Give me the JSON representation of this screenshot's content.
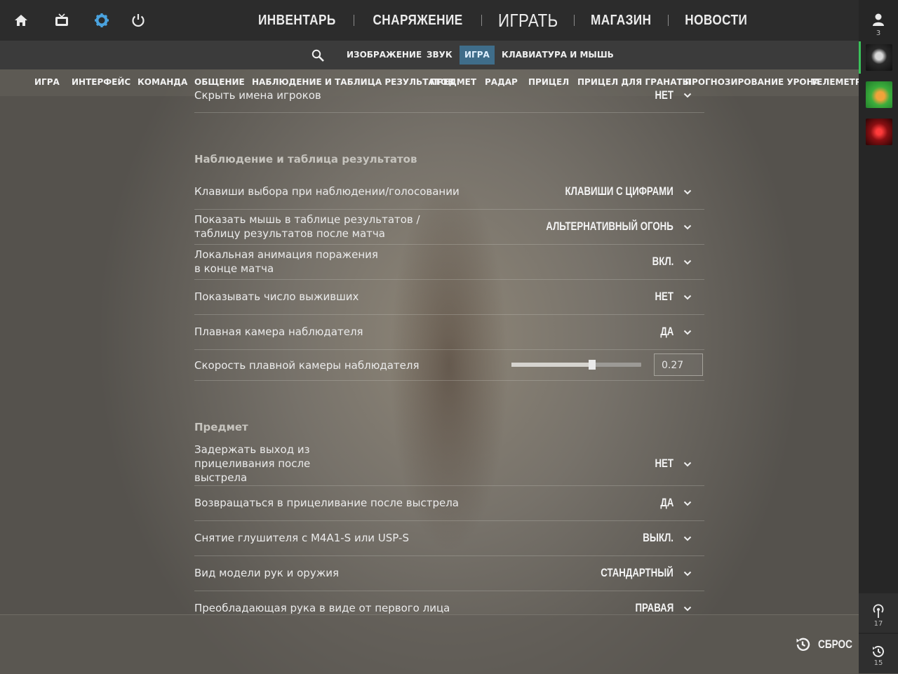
{
  "topbar": {
    "icons": [
      "home-icon",
      "tv-icon",
      "gear-icon",
      "power-icon"
    ],
    "nav": [
      "ИНВЕНТАРЬ",
      "СНАРЯЖЕНИЕ",
      "ИГРАТЬ",
      "МАГАЗИН",
      "НОВОСТИ"
    ],
    "accent": "#4aa3df"
  },
  "rail": {
    "friends_count": "3",
    "notifications_count": "17",
    "history_count": "15",
    "online_color": "#3ac15a"
  },
  "subnav": {
    "tabs": [
      "ИЗОБРАЖЕНИЕ",
      "ЗВУК",
      "ИГРА",
      "КЛАВИАТУРА И МЫШЬ"
    ],
    "active": "ИГРА"
  },
  "sections": [
    "ИГРА",
    "ИНТЕРФЕЙС",
    "КОМАНДА",
    "ОБЩЕНИЕ",
    "НАБЛЮДЕНИЕ И ТАБЛИЦА РЕЗУЛЬТАТОВ",
    "ПРЕДМЕТ",
    "РАДАР",
    "ПРИЦЕЛ",
    "ПРИЦЕЛ ДЛЯ ГРАНАТЫ",
    "ПРОГНОЗИРОВАНИЕ УРОНА",
    "ТЕЛЕМЕТРИ"
  ],
  "partial_row": {
    "label": "Скрыть имена игроков",
    "value": "НЕТ"
  },
  "spectate": {
    "title": "Наблюдение и таблица результатов",
    "rows": [
      {
        "label": "Клавиши выбора при наблюдении/голосовании",
        "value": "КЛАВИШИ С ЦИФРАМИ"
      },
      {
        "label": "Показать мышь в таблице результатов /\nтаблицу результатов после матча",
        "value": "АЛЬТЕРНАТИВНЫЙ ОГОНЬ"
      },
      {
        "label": "Локальная анимация поражения\nв конце матча",
        "value": "ВКЛ."
      },
      {
        "label": "Показывать число выживших",
        "value": "НЕТ"
      },
      {
        "label": "Плавная камера наблюдателя",
        "value": "ДА"
      }
    ],
    "slider": {
      "label": "Скорость плавной камеры наблюдателя",
      "value": "0.27",
      "fraction": 0.62
    }
  },
  "item": {
    "title": "Предмет",
    "rows": [
      {
        "label": "Задержать выход из\nприцеливания после\nвыстрела",
        "value": "НЕТ"
      },
      {
        "label": "Возвращаться в прицеливание после выстрела",
        "value": "ДА"
      },
      {
        "label": "Снятие глушителя с M4A1-S или USP-S",
        "value": "ВЫКЛ."
      },
      {
        "label": "Вид модели рук и оружия",
        "value": "СТАНДАРТНЫЙ"
      },
      {
        "label": "Преобладающая рука в виде от первого лица",
        "value": "ПРАВАЯ"
      }
    ]
  },
  "footer": {
    "reset_label": "СБРОС"
  }
}
